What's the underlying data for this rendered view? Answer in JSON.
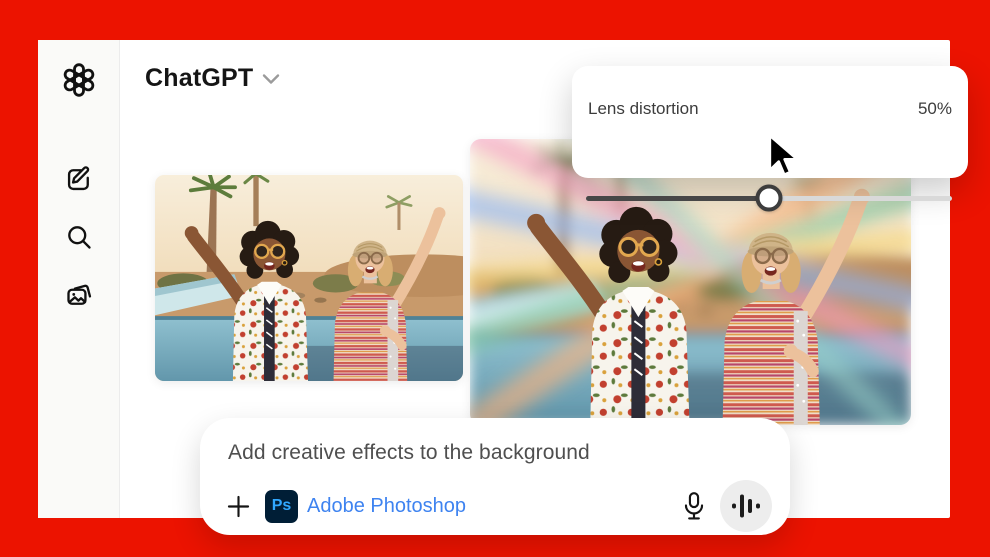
{
  "header": {
    "title": "ChatGPT"
  },
  "sidebar": {
    "items": [
      {
        "icon": "openai-logo"
      },
      {
        "icon": "new-chat-icon"
      },
      {
        "icon": "search-icon"
      },
      {
        "icon": "library-icon"
      }
    ]
  },
  "lens_panel": {
    "label": "Lens distortion",
    "value": "50%",
    "slider_percent": 50
  },
  "composer": {
    "prompt": "Add creative effects to the background",
    "app_badge": "Ps",
    "app_name": "Adobe Photoshop"
  },
  "colors": {
    "frame_red": "#ec1300",
    "photoshop_blue": "#31a8ff",
    "ps_badge_bg": "#001e36",
    "app_link_blue": "#3e83f0"
  }
}
